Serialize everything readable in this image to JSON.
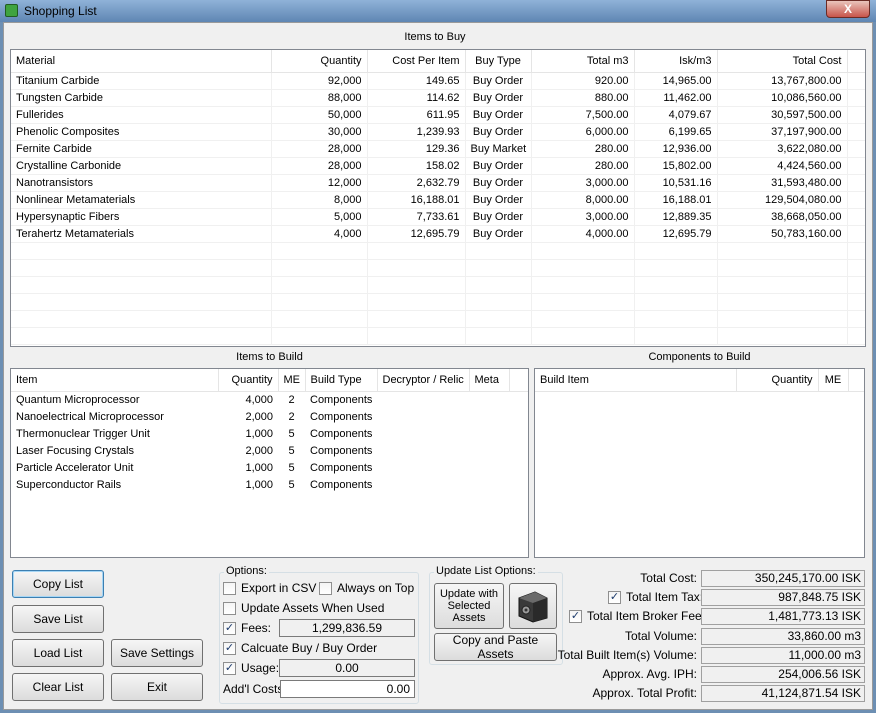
{
  "window": {
    "title": "Shopping List",
    "close_label": "X"
  },
  "items_to_buy": {
    "title": "Items to Buy",
    "columns": [
      "Material",
      "Quantity",
      "Cost Per Item",
      "Buy Type",
      "Total m3",
      "Isk/m3",
      "Total Cost"
    ],
    "rows": [
      [
        "Titanium Carbide",
        "92,000",
        "149.65",
        "Buy Order",
        "920.00",
        "14,965.00",
        "13,767,800.00"
      ],
      [
        "Tungsten Carbide",
        "88,000",
        "114.62",
        "Buy Order",
        "880.00",
        "11,462.00",
        "10,086,560.00"
      ],
      [
        "Fullerides",
        "50,000",
        "611.95",
        "Buy Order",
        "7,500.00",
        "4,079.67",
        "30,597,500.00"
      ],
      [
        "Phenolic Composites",
        "30,000",
        "1,239.93",
        "Buy Order",
        "6,000.00",
        "6,199.65",
        "37,197,900.00"
      ],
      [
        "Fernite Carbide",
        "28,000",
        "129.36",
        "Buy Market",
        "280.00",
        "12,936.00",
        "3,622,080.00"
      ],
      [
        "Crystalline Carbonide",
        "28,000",
        "158.02",
        "Buy Order",
        "280.00",
        "15,802.00",
        "4,424,560.00"
      ],
      [
        "Nanotransistors",
        "12,000",
        "2,632.79",
        "Buy Order",
        "3,000.00",
        "10,531.16",
        "31,593,480.00"
      ],
      [
        "Nonlinear Metamaterials",
        "8,000",
        "16,188.01",
        "Buy Order",
        "8,000.00",
        "16,188.01",
        "129,504,080.00"
      ],
      [
        "Hypersynaptic Fibers",
        "5,000",
        "7,733.61",
        "Buy Order",
        "3,000.00",
        "12,889.35",
        "38,668,050.00"
      ],
      [
        "Terahertz Metamaterials",
        "4,000",
        "12,695.79",
        "Buy Order",
        "4,000.00",
        "12,695.79",
        "50,783,160.00"
      ]
    ]
  },
  "items_to_build": {
    "title": "Items to Build",
    "columns": [
      "Item",
      "Quantity",
      "ME",
      "Build Type",
      "Decryptor / Relic",
      "Meta"
    ],
    "rows": [
      [
        "Quantum Microprocessor",
        "4,000",
        "2",
        "Components",
        "",
        ""
      ],
      [
        "Nanoelectrical Microprocessor",
        "2,000",
        "2",
        "Components",
        "",
        ""
      ],
      [
        "Thermonuclear Trigger Unit",
        "1,000",
        "5",
        "Components",
        "",
        ""
      ],
      [
        "Laser Focusing Crystals",
        "2,000",
        "5",
        "Components",
        "",
        ""
      ],
      [
        "Particle Accelerator Unit",
        "1,000",
        "5",
        "Components",
        "",
        ""
      ],
      [
        "Superconductor Rails",
        "1,000",
        "5",
        "Components",
        "",
        ""
      ]
    ]
  },
  "components_to_build": {
    "title": "Components to Build",
    "columns": [
      "Build Item",
      "Quantity",
      "ME"
    ]
  },
  "buttons": {
    "copy_list": "Copy List",
    "save_list": "Save List",
    "load_list": "Load List",
    "save_settings": "Save Settings",
    "clear_list": "Clear List",
    "exit": "Exit"
  },
  "options": {
    "title": "Options:",
    "export_csv": {
      "label": "Export in CSV",
      "checked": false
    },
    "always_on_top": {
      "label": "Always on Top",
      "checked": false
    },
    "update_assets": {
      "label": "Update Assets When Used",
      "checked": false
    },
    "fees": {
      "label": "Fees:",
      "checked": true,
      "value": "1,299,836.59"
    },
    "calc_buy_order": {
      "label": "Calcuate Buy / Buy Order",
      "checked": true
    },
    "usage": {
      "label": "Usage:",
      "checked": true,
      "value": "0.00"
    },
    "addl_costs": {
      "label": "Add'l Costs:",
      "value": "0.00"
    }
  },
  "update_list_options": {
    "title": "Update List Options:",
    "update_assets_button": "Update with Selected Assets",
    "safe_icon": "safe-icon",
    "copy_paste_button": "Copy and Paste Assets"
  },
  "summary": {
    "total_cost": {
      "label": "Total Cost:",
      "value": "350,245,170.00 ISK"
    },
    "total_item_tax": {
      "label": "Total Item Tax:",
      "value": "987,848.75 ISK",
      "checked": true
    },
    "total_broker_fees": {
      "label": "Total Item Broker Fees:",
      "value": "1,481,773.13 ISK",
      "checked": true
    },
    "total_volume": {
      "label": "Total Volume:",
      "value": "33,860.00 m3"
    },
    "total_built_volume": {
      "label": "Total Built Item(s) Volume:",
      "value": "11,000.00 m3"
    },
    "avg_iph": {
      "label": "Approx. Avg. IPH:",
      "value": "254,006.56 ISK"
    },
    "total_profit": {
      "label": "Approx. Total Profit:",
      "value": "41,124,871.54 ISK"
    }
  },
  "colors": {
    "titlebar": "#6d8fb3",
    "close": "#c8544a",
    "window_bg": "#f0f0f0"
  }
}
